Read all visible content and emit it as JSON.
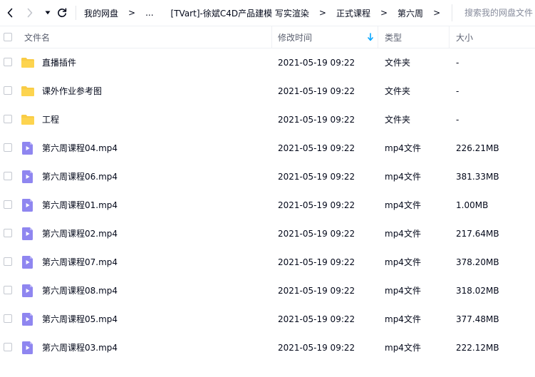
{
  "nav": {
    "breadcrumbs": [
      "我的网盘",
      "...",
      "[TVart]-徐斌C4D产品建模 写实渲染",
      "正式课程",
      "第六周"
    ],
    "separator": ">",
    "search_placeholder": "搜索我的网盘文件"
  },
  "table": {
    "headers": {
      "name": "文件名",
      "modified": "修改时间",
      "type": "类型",
      "size": "大小"
    },
    "sorted_by": "modified",
    "sort_direction": "descending",
    "rows": [
      {
        "icon": "folder-icon",
        "name": "直播插件",
        "modified": "2021-05-19 09:22",
        "type": "文件夹",
        "size": "-"
      },
      {
        "icon": "folder-icon",
        "name": "课外作业参考图",
        "modified": "2021-05-19 09:22",
        "type": "文件夹",
        "size": "-"
      },
      {
        "icon": "folder-icon",
        "name": "工程",
        "modified": "2021-05-19 09:22",
        "type": "文件夹",
        "size": "-"
      },
      {
        "icon": "video-file-icon",
        "name": "第六周课程04.mp4",
        "modified": "2021-05-19 09:22",
        "type": "mp4文件",
        "size": "226.21MB"
      },
      {
        "icon": "video-file-icon",
        "name": "第六周课程06.mp4",
        "modified": "2021-05-19 09:22",
        "type": "mp4文件",
        "size": "381.33MB"
      },
      {
        "icon": "video-file-icon",
        "name": "第六周课程01.mp4",
        "modified": "2021-05-19 09:22",
        "type": "mp4文件",
        "size": "1.00MB"
      },
      {
        "icon": "video-file-icon",
        "name": "第六周课程02.mp4",
        "modified": "2021-05-19 09:22",
        "type": "mp4文件",
        "size": "217.64MB"
      },
      {
        "icon": "video-file-icon",
        "name": "第六周课程07.mp4",
        "modified": "2021-05-19 09:22",
        "type": "mp4文件",
        "size": "378.20MB"
      },
      {
        "icon": "video-file-icon",
        "name": "第六周课程08.mp4",
        "modified": "2021-05-19 09:22",
        "type": "mp4文件",
        "size": "318.02MB"
      },
      {
        "icon": "video-file-icon",
        "name": "第六周课程05.mp4",
        "modified": "2021-05-19 09:22",
        "type": "mp4文件",
        "size": "377.48MB"
      },
      {
        "icon": "video-file-icon",
        "name": "第六周课程03.mp4",
        "modified": "2021-05-19 09:22",
        "type": "mp4文件",
        "size": "222.12MB"
      }
    ]
  },
  "colors": {
    "text": "#03081a",
    "muted_text": "#878c9c",
    "folder": "#f9cc46",
    "video_icon": "#8f86f0",
    "sort_arrow": "#06a7ff"
  }
}
